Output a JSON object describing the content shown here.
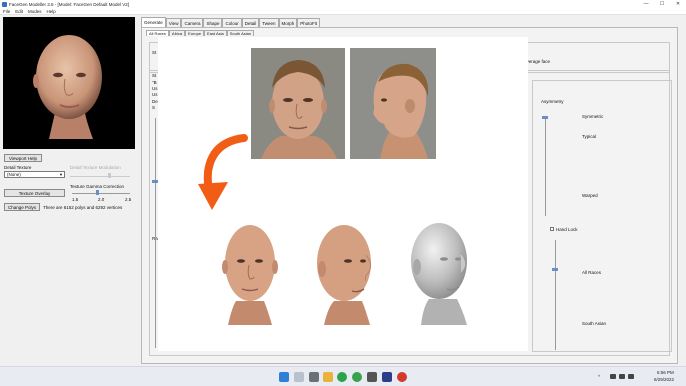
{
  "window": {
    "title": "FaceGen Modeller 3.5 - [Model: FaceGen Default Model V2]",
    "controls": [
      "—",
      "☐",
      "✕"
    ]
  },
  "menu": [
    "File",
    "Edit",
    "Modes",
    "Help"
  ],
  "left_panel": {
    "viewport_help": "Viewport Help",
    "detail_texture_label": "Detail Texture",
    "detail_texture_value": "(None)",
    "modulation_label": "Detail Texture Modulation",
    "texture_overlay": "Texture Overlay",
    "gamma_label": "Texture Gamma Correction",
    "gamma_ticks": [
      "1.5",
      "2.0",
      "2.5"
    ],
    "change_polys": "Change Polys",
    "polys_info": "There are 6152 polys and 6292 vertices"
  },
  "tabs": [
    "Generate",
    "View",
    "Camera",
    "Shape",
    "Colour",
    "Detail",
    "Tween",
    "Morph",
    "PhotoFit"
  ],
  "active_tab": "Generate",
  "subtabs": [
    "All Races",
    "Africa",
    "Europe",
    "East Asia",
    "South Asian"
  ],
  "hidden_fragments": {
    "st": "St",
    "st2": "St",
    "b_char": "\"B",
    "us1": "Us",
    "us2": "Us",
    "de": "De",
    "s_char": "S",
    "ra": "Ra"
  },
  "average_faces": "average face",
  "asymmetry": {
    "title": "Asymmetry",
    "labels": [
      "Symmetric",
      "Typical",
      "Warped"
    ]
  },
  "hand_lock": "Hand Lock",
  "race_slider": {
    "labels": [
      "All Races",
      "South Asian"
    ]
  },
  "taskbar": {
    "time": "6:56 PM",
    "date": "6/29/2022",
    "tray_caret": "^"
  },
  "colors": {
    "accent": "#6b8fc4",
    "arrow": "#f25d15",
    "taskbar": "#e8ecf2"
  }
}
